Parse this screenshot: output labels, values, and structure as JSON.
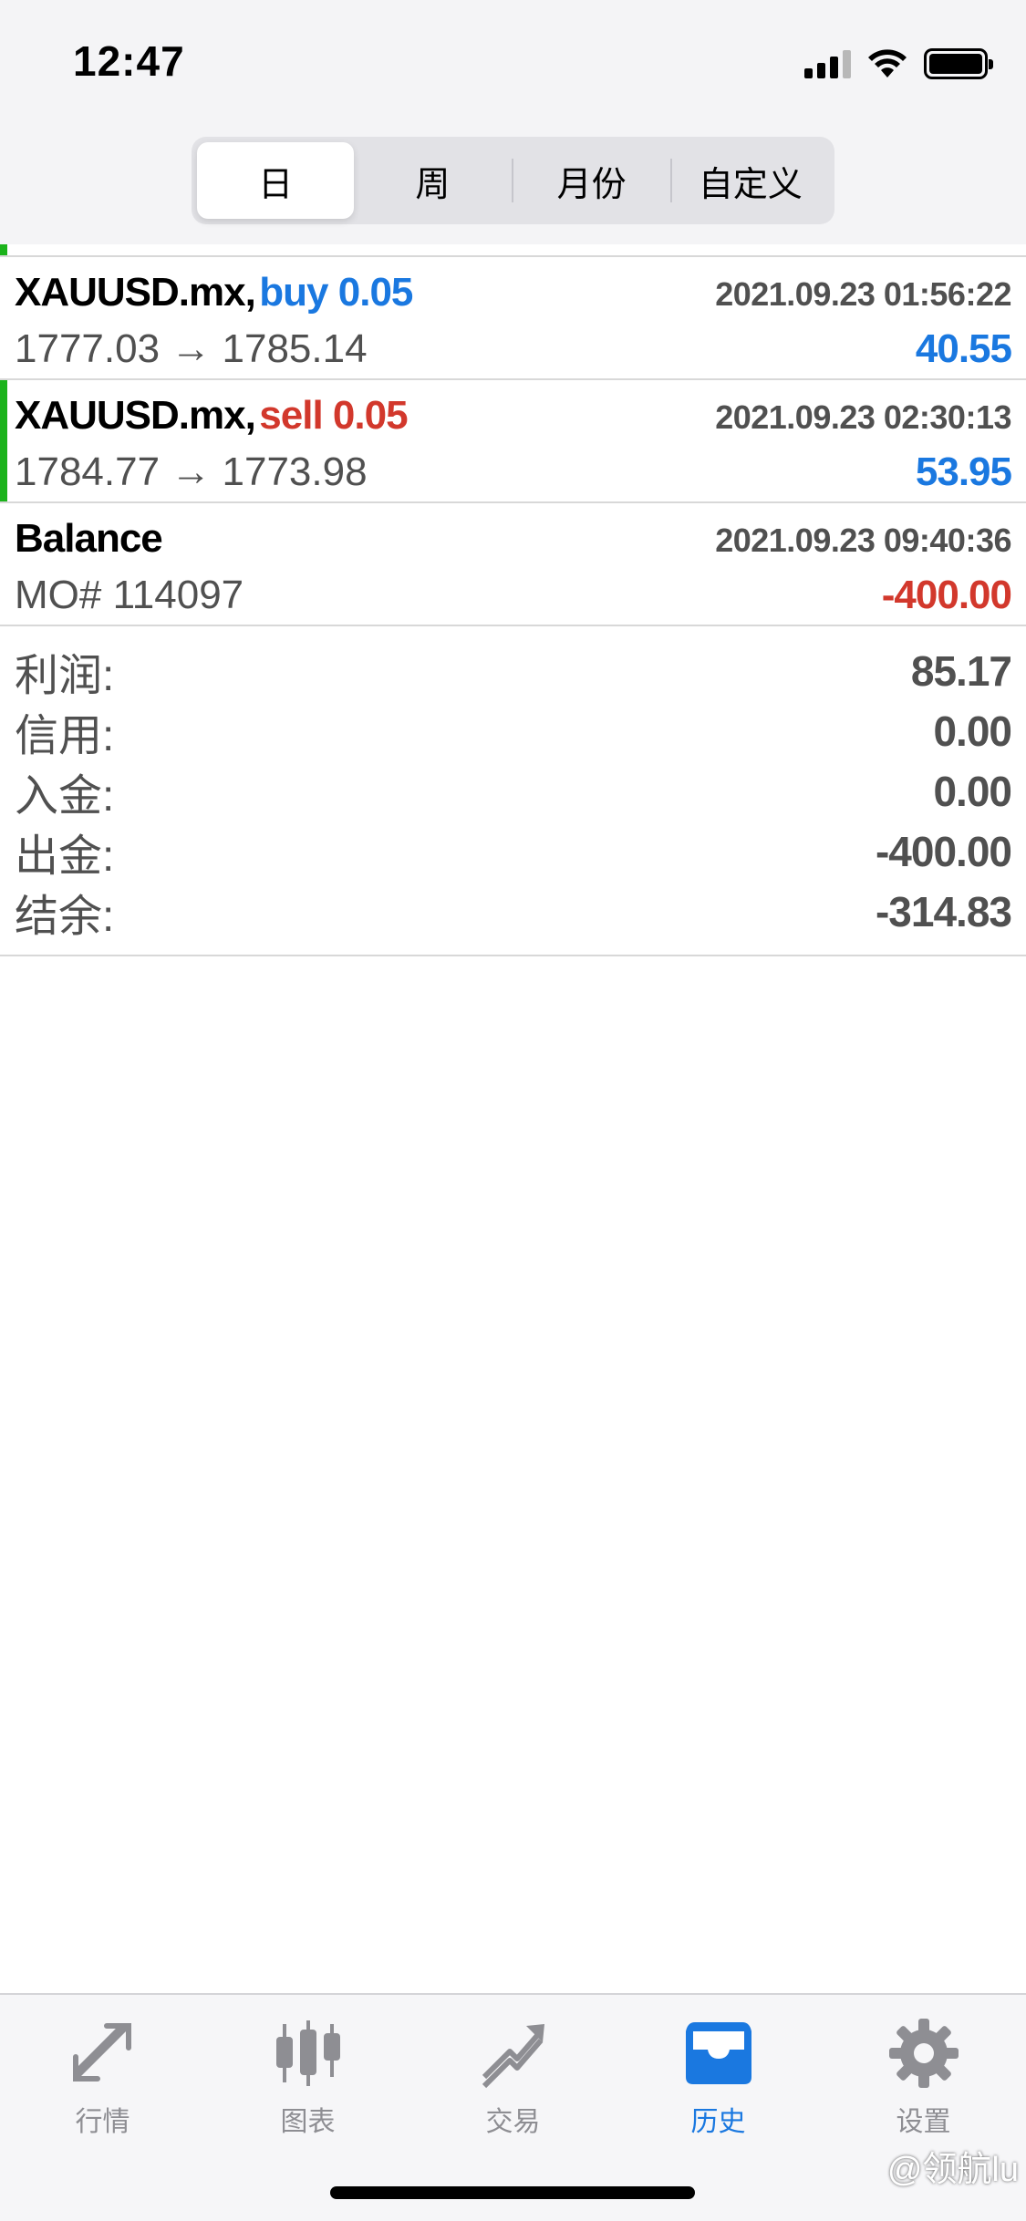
{
  "status_bar": {
    "time": "12:47"
  },
  "segments": [
    {
      "label": "日",
      "active": true
    },
    {
      "label": "周",
      "active": false
    },
    {
      "label": "月份",
      "active": false
    },
    {
      "label": "自定义",
      "active": false
    }
  ],
  "trades": [
    {
      "symbol": "XAUUSD.mx,",
      "side": "buy 0.05",
      "side_type": "buy",
      "datetime": "2021.09.23 01:56:22",
      "prices": "1777.03 → 1785.14",
      "profit": "40.55",
      "profit_sign": "pos",
      "accent": false
    },
    {
      "symbol": "XAUUSD.mx,",
      "side": "sell 0.05",
      "side_type": "sell",
      "datetime": "2021.09.23 02:30:13",
      "prices": "1784.77 → 1773.98",
      "profit": "53.95",
      "profit_sign": "pos",
      "accent": true
    },
    {
      "symbol": "Balance",
      "side": "",
      "side_type": "none",
      "datetime": "2021.09.23 09:40:36",
      "prices": "MO# 114097",
      "profit": "-400.00",
      "profit_sign": "neg",
      "accent": false
    }
  ],
  "summary": [
    {
      "label": "利润:",
      "value": "85.17"
    },
    {
      "label": "信用:",
      "value": "0.00"
    },
    {
      "label": "入金:",
      "value": "0.00"
    },
    {
      "label": "出金:",
      "value": "-400.00"
    },
    {
      "label": "结余:",
      "value": "-314.83"
    }
  ],
  "tabs": [
    {
      "label": "行情",
      "icon": "quotes-icon",
      "active": false
    },
    {
      "label": "图表",
      "icon": "chart-icon",
      "active": false
    },
    {
      "label": "交易",
      "icon": "trade-icon",
      "active": false
    },
    {
      "label": "历史",
      "icon": "history-icon",
      "active": true
    },
    {
      "label": "设置",
      "icon": "settings-icon",
      "active": false
    }
  ],
  "watermark": "@领航lu",
  "colors": {
    "blue": "#1a78e0",
    "red": "#d2382c",
    "green": "#1bb31b",
    "gray": "#505050"
  }
}
